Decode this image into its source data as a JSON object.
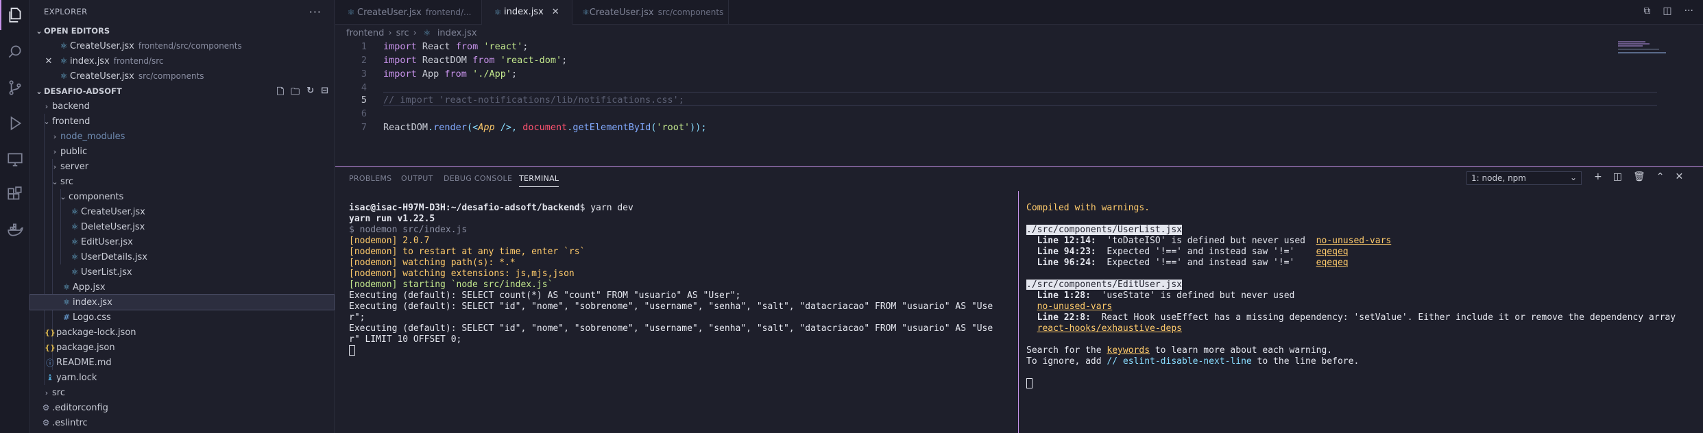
{
  "sidebar": {
    "title": "EXPLORER",
    "open_editors": {
      "label": "OPEN EDITORS",
      "items": [
        {
          "name": "CreateUser.jsx",
          "desc": "frontend/src/components"
        },
        {
          "name": "index.jsx",
          "desc": "frontend/src"
        },
        {
          "name": "CreateUser.jsx",
          "desc": "src/components"
        }
      ]
    },
    "project": {
      "label": "DESAFIO-ADSOFT",
      "tree": [
        {
          "name": "backend"
        },
        {
          "name": "frontend"
        },
        {
          "name": "node_modules"
        },
        {
          "name": "public"
        },
        {
          "name": "server"
        },
        {
          "name": "src"
        },
        {
          "name": "components"
        },
        {
          "name": "CreateUser.jsx"
        },
        {
          "name": "DeleteUser.jsx"
        },
        {
          "name": "EditUser.jsx"
        },
        {
          "name": "UserDetails.jsx"
        },
        {
          "name": "UserList.jsx"
        },
        {
          "name": "App.jsx"
        },
        {
          "name": "index.jsx"
        },
        {
          "name": "Logo.css"
        },
        {
          "name": "package-lock.json"
        },
        {
          "name": "package.json"
        },
        {
          "name": "README.md"
        },
        {
          "name": "yarn.lock"
        },
        {
          "name": "src"
        },
        {
          "name": ".editorconfig"
        },
        {
          "name": ".eslintrc"
        }
      ]
    }
  },
  "tabs": [
    {
      "name": "CreateUser.jsx",
      "desc": "frontend/..."
    },
    {
      "name": "index.jsx",
      "desc": ""
    },
    {
      "name": "CreateUser.jsx",
      "desc": "src/components"
    }
  ],
  "breadcrumb": {
    "parts": [
      "frontend",
      "src",
      "index.jsx"
    ]
  },
  "editor": {
    "line_numbers": [
      "1",
      "2",
      "3",
      "4",
      "5",
      "6",
      "7"
    ],
    "lines": [
      {
        "a": "import",
        "b": " React ",
        "c": "from",
        "d": " 'react'",
        "e": ";"
      },
      {
        "a": "import",
        "b": " ReactDOM ",
        "c": "from",
        "d": " 'react-dom'",
        "e": ";"
      },
      {
        "a": "import",
        "b": " App ",
        "c": "from",
        "d": " './App'",
        "e": ";"
      },
      {},
      {
        "comment": "// import 'react-notifications/lib/notifications.css';"
      },
      {},
      {
        "l7a": "ReactDOM",
        "l7b": ".",
        "l7c": "render",
        "l7d": "(<",
        "l7e": "App",
        "l7f": " />, ",
        "l7g": "document",
        "l7h": ".",
        "l7i": "getElementById",
        "l7j": "(",
        "l7k": "'root'",
        "l7l": "));"
      }
    ]
  },
  "panel": {
    "tabs": [
      "PROBLEMS",
      "OUTPUT",
      "DEBUG CONSOLE",
      "TERMINAL"
    ],
    "terminal_select": "1: node, npm",
    "left_terminal": {
      "prompt_user": "isac@isac-H97M-D3H",
      "prompt_path": ":~/desafio-adsoft/backend",
      "prompt_cmd": "$ yarn dev",
      "lines": [
        "yarn run v1.22.5",
        "$ nodemon src/index.js",
        "[nodemon] 2.0.7",
        "[nodemon] to restart at any time, enter `rs`",
        "[nodemon] watching path(s): *.*",
        "[nodemon] watching extensions: js,mjs,json",
        "[nodemon] starting `node src/index.js`",
        "Executing (default): SELECT count(*) AS \"count\" FROM \"usuario\" AS \"User\";",
        "Executing (default): SELECT \"id\", \"nome\", \"sobrenome\", \"username\", \"senha\", \"salt\", \"datacriacao\" FROM \"usuario\" AS \"Use",
        "r\";",
        "Executing (default): SELECT \"id\", \"nome\", \"sobrenome\", \"username\", \"senha\", \"salt\", \"datacriacao\" FROM \"usuario\" AS \"Use",
        "r\" LIMIT 10 OFFSET 0;"
      ]
    },
    "right_terminal": {
      "compiled": "Compiled with warnings.",
      "file1": "./src/components/UserList.jsx",
      "w1a_loc": "Line 12:14:",
      "w1a_msg": "  'toDateISO' is defined but never used  ",
      "w1a_rule": "no-unused-vars",
      "w1b_loc": "Line 94:23:",
      "w1b_msg": "  Expected '!==' and instead saw '!='    ",
      "w1b_rule": "eqeqeq",
      "w1c_loc": "Line 96:24:",
      "w1c_msg": "  Expected '!==' and instead saw '!='    ",
      "w1c_rule": "eqeqeq",
      "file2": "./src/components/EditUser.jsx",
      "w2a_loc": "Line 1:28:",
      "w2a_msg": "  'useState' is defined but never used",
      "w2a_rule": "no-unused-vars",
      "w2b_loc": "Line 22:8:",
      "w2b_msg": "  React Hook useEffect has a missing dependency: 'setValue'. Either include it or remove the dependency array",
      "w2b_rule": "react-hooks/exhaustive-deps",
      "search_a": "Search for the ",
      "search_kw": "keywords",
      "search_b": " to learn more about each warning.",
      "ignore_a": "To ignore, add ",
      "ignore_code": "// eslint-disable-next-line",
      "ignore_b": " to the line before."
    }
  },
  "colors": {
    "accent": "#c792ea",
    "background": "#1e1f2b",
    "sidebar": "#1e1f2b",
    "activity": "#1a1b26"
  }
}
